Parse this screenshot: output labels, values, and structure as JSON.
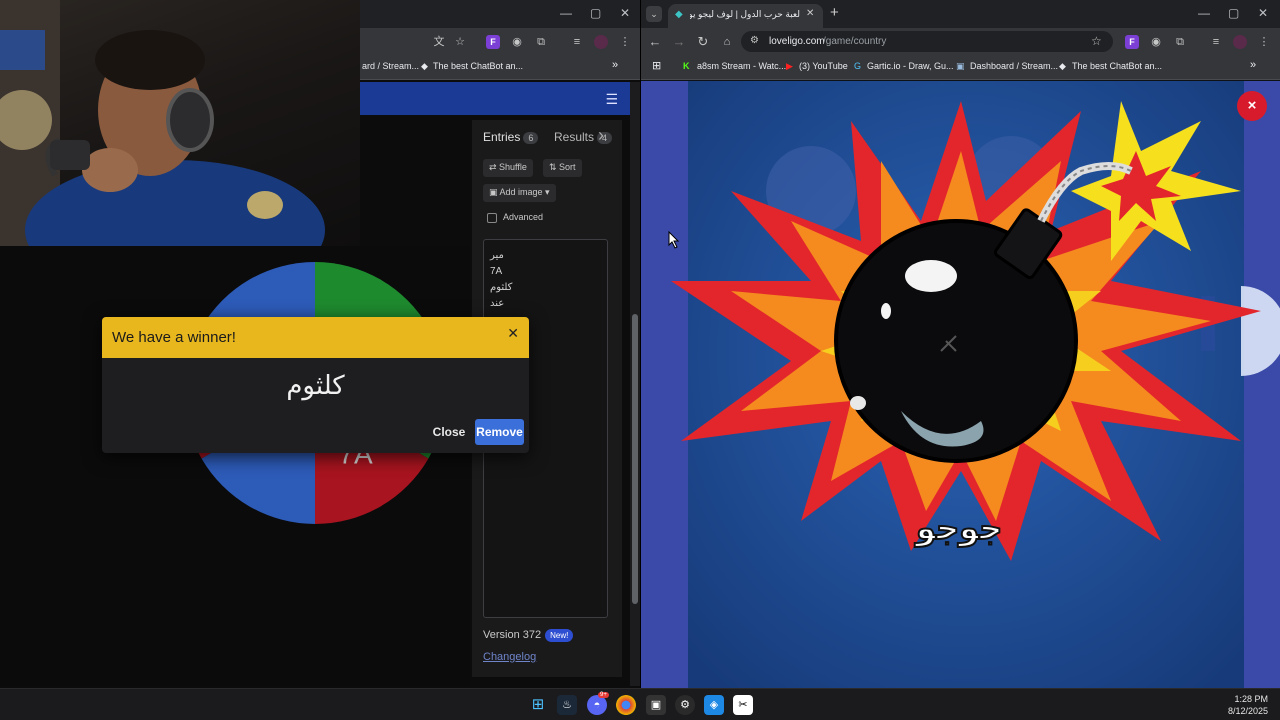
{
  "left_window": {
    "bookmarks": [
      "ard / Stream...",
      "The best ChatBot an..."
    ],
    "wheel": {
      "slices": [
        {
          "label": "",
          "color": "#2d5bb8"
        },
        {
          "label": "",
          "color": "#1e8a2e"
        },
        {
          "label": "",
          "color": "#1e8a2e"
        },
        {
          "label": "7A",
          "color": "#a8141f"
        },
        {
          "label": "",
          "color": "#2d5bb8"
        },
        {
          "label": "",
          "color": "#a8141f"
        }
      ]
    },
    "modal": {
      "title": "We have a winner!",
      "winner": "كلثوم",
      "close_label": "Close",
      "remove_label": "Remove"
    },
    "entries_panel": {
      "entries_tab": "Entries",
      "entries_count": "6",
      "results_tab": "Results",
      "results_count": "4",
      "shuffle_label": "Shuffle",
      "sort_label": "Sort",
      "add_image_label": "Add image",
      "advanced_label": "Advanced",
      "entries": [
        "مير",
        "7A",
        "كلثوم",
        "عند"
      ],
      "version_label": "Version 372",
      "new_badge": "New!",
      "changelog_label": "Changelog"
    }
  },
  "right_window": {
    "tab_title": "لعبة حرب الدول | لوف ليجو يوفر",
    "url_host": "loveligo.com",
    "url_path": "/game/country",
    "bookmarks": [
      "a8sm Stream - Watc...",
      "(3) YouTube",
      "Gartic.io - Draw, Gu...",
      "Dashboard / Stream...",
      "The best ChatBot an..."
    ],
    "game": {
      "player_name": "جوجو",
      "close_symbol": "×"
    }
  },
  "taskbar": {
    "time": "1:28 PM",
    "date": "8/12/2025",
    "discord_badge": "9+"
  },
  "colors": {
    "modal_header": "#e8b71e",
    "remove_button": "#3b6fd9",
    "wheel_header": "#1b3a96",
    "game_close": "#d81b2c"
  }
}
